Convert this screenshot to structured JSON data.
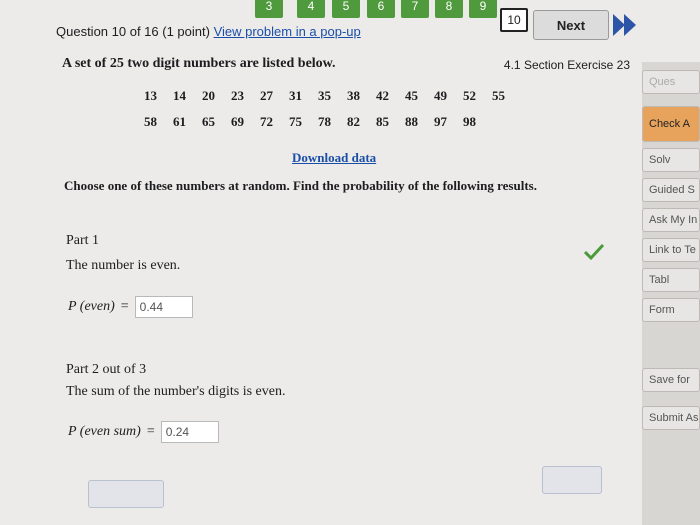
{
  "nav": {
    "numbers": [
      "3",
      "4",
      "5",
      "6",
      "7",
      "8",
      "9"
    ],
    "current": "10",
    "next_label": "Next"
  },
  "question": {
    "header": "Question 10 of 16 (1 point)",
    "popup_link": "View problem in a pop-up",
    "section": "4.1 Section Exercise 23",
    "intro": "A set of 25 two digit numbers are listed below.",
    "row1": [
      "13",
      "14",
      "20",
      "23",
      "27",
      "31",
      "35",
      "38",
      "42",
      "45",
      "49",
      "52",
      "55"
    ],
    "row2": [
      "58",
      "61",
      "65",
      "69",
      "72",
      "75",
      "78",
      "82",
      "85",
      "88",
      "97",
      "98"
    ],
    "download": "Download data",
    "instruction": "Choose one of these numbers at random. Find the probability of the following results."
  },
  "part1": {
    "title": "Part 1",
    "text": "The number is even.",
    "label": "P (even)",
    "equals": "=",
    "value": "0.44"
  },
  "part2": {
    "title": "Part 2 out of 3",
    "text": "The sum of the number's digits is even.",
    "label": "P (even sum)",
    "equals": "=",
    "value": "0.24"
  },
  "sidebar": {
    "items": [
      "Ques",
      "Check A",
      "Solv",
      "Guided S",
      "Ask My In",
      "Link to Te",
      "Tabl",
      "Form",
      "Save for",
      "Submit Ass"
    ]
  },
  "colors": {
    "accent_orange": "#e7a35c",
    "nav_green": "#4f9a3c",
    "link_blue": "#1a4fa8",
    "check_green": "#4a9a3a"
  }
}
